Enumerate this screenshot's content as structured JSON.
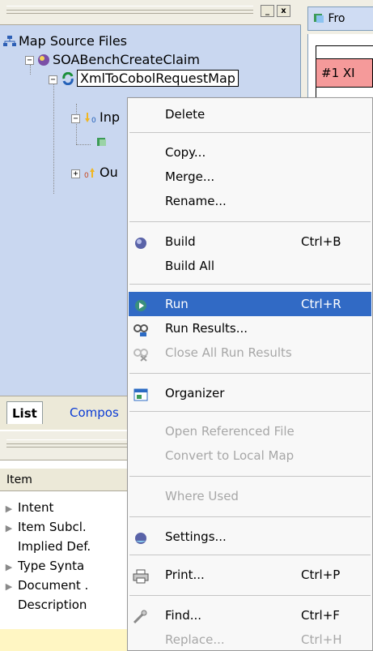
{
  "navigator": {
    "root_label": "Map Source Files",
    "project_label": "SOABenchCreateClaim",
    "map_label": "XmlToCobolRequestMap",
    "input_label": "Inp",
    "output_label": "Ou",
    "minimize_glyph": "_",
    "close_glyph": "x",
    "tabs": [
      "List",
      "Compos"
    ]
  },
  "properties": {
    "column_header": "Item",
    "rows": [
      {
        "label": "Intent",
        "expandable": true
      },
      {
        "label": "Item Subcl.",
        "expandable": true
      },
      {
        "label": "Implied Def.",
        "expandable": false
      },
      {
        "label": "Type Synta",
        "expandable": true
      },
      {
        "label": "Document .",
        "expandable": true
      },
      {
        "label": "Description",
        "expandable": false
      }
    ]
  },
  "editor": {
    "tab_label": "Fro",
    "cell_label": "#1 XI"
  },
  "context_menu": {
    "items": [
      {
        "label": "Delete",
        "shortcut": "",
        "icon": "",
        "enabled": true,
        "highlighted": false
      },
      {
        "label": "Copy...",
        "shortcut": "",
        "icon": "",
        "enabled": true,
        "highlighted": false
      },
      {
        "label": "Merge...",
        "shortcut": "",
        "icon": "",
        "enabled": true,
        "highlighted": false
      },
      {
        "label": "Rename...",
        "shortcut": "",
        "icon": "",
        "enabled": true,
        "highlighted": false
      },
      {
        "label": "Build",
        "shortcut": "Ctrl+B",
        "icon": "build-icon",
        "enabled": true,
        "highlighted": false
      },
      {
        "label": "Build All",
        "shortcut": "",
        "icon": "",
        "enabled": true,
        "highlighted": false
      },
      {
        "label": "Run",
        "shortcut": "Ctrl+R",
        "icon": "run-icon",
        "enabled": true,
        "highlighted": true
      },
      {
        "label": "Run Results...",
        "shortcut": "",
        "icon": "run-results-icon",
        "enabled": true,
        "highlighted": false
      },
      {
        "label": "Close All Run Results",
        "shortcut": "",
        "icon": "close-run-results-icon",
        "enabled": false,
        "highlighted": false
      },
      {
        "label": "Organizer",
        "shortcut": "",
        "icon": "organizer-icon",
        "enabled": true,
        "highlighted": false
      },
      {
        "label": "Open Referenced File",
        "shortcut": "",
        "icon": "",
        "enabled": false,
        "highlighted": false
      },
      {
        "label": "Convert to Local Map",
        "shortcut": "",
        "icon": "",
        "enabled": false,
        "highlighted": false
      },
      {
        "label": "Where Used",
        "shortcut": "",
        "icon": "",
        "enabled": false,
        "highlighted": false
      },
      {
        "label": "Settings...",
        "shortcut": "",
        "icon": "settings-icon",
        "enabled": true,
        "highlighted": false
      },
      {
        "label": "Print...",
        "shortcut": "Ctrl+P",
        "icon": "print-icon",
        "enabled": true,
        "highlighted": false
      },
      {
        "label": "Find...",
        "shortcut": "Ctrl+F",
        "icon": "find-icon",
        "enabled": true,
        "highlighted": false
      },
      {
        "label": "Replace...",
        "shortcut": "Ctrl+H",
        "icon": "",
        "enabled": false,
        "highlighted": false
      }
    ]
  },
  "colors": {
    "highlight": "#316ac5",
    "navigator_bg": "#c9d7f0",
    "disabled_text": "#a7a7a7",
    "editor_cell": "#f59a9a"
  }
}
